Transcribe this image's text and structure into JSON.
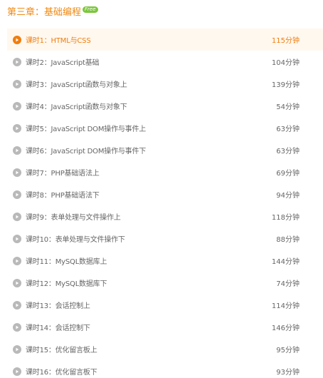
{
  "chapter": {
    "title": "第三章：基础编程",
    "badge": "Free"
  },
  "colors": {
    "accent": "#f07d0e",
    "active_background": "#fff8ef",
    "badge": "#7cc63d",
    "icon_inactive": "#b9b9b9",
    "text": "#666666"
  },
  "lessons": [
    {
      "label": "课时1：HTML与CSS",
      "duration": "115分钟",
      "active": true,
      "icon": "play-circle-icon"
    },
    {
      "label": "课时2：JavaScript基础",
      "duration": "104分钟",
      "active": false,
      "icon": "play-circle-icon"
    },
    {
      "label": "课时3：JavaScript函数与对象上",
      "duration": "139分钟",
      "active": false,
      "icon": "play-circle-icon"
    },
    {
      "label": "课时4：JavaScript函数与对象下",
      "duration": "54分钟",
      "active": false,
      "icon": "play-circle-icon"
    },
    {
      "label": "课时5：JavaScript DOM操作与事件上",
      "duration": "63分钟",
      "active": false,
      "icon": "play-circle-icon"
    },
    {
      "label": "课时6：JavaScript DOM操作与事件下",
      "duration": "63分钟",
      "active": false,
      "icon": "play-circle-icon"
    },
    {
      "label": "课时7：PHP基础语法上",
      "duration": "69分钟",
      "active": false,
      "icon": "play-circle-icon"
    },
    {
      "label": "课时8：PHP基础语法下",
      "duration": "94分钟",
      "active": false,
      "icon": "play-circle-icon"
    },
    {
      "label": "课时9：表单处理与文件操作上",
      "duration": "118分钟",
      "active": false,
      "icon": "play-circle-icon"
    },
    {
      "label": "课时10：表单处理与文件操作下",
      "duration": "88分钟",
      "active": false,
      "icon": "play-circle-icon"
    },
    {
      "label": "课时11：MySQL数据库上",
      "duration": "144分钟",
      "active": false,
      "icon": "play-circle-icon"
    },
    {
      "label": "课时12：MySQL数据库下",
      "duration": "74分钟",
      "active": false,
      "icon": "play-circle-icon"
    },
    {
      "label": "课时13：会话控制上",
      "duration": "114分钟",
      "active": false,
      "icon": "play-circle-icon"
    },
    {
      "label": "课时14：会话控制下",
      "duration": "146分钟",
      "active": false,
      "icon": "play-circle-icon"
    },
    {
      "label": "课时15：优化留言板上",
      "duration": "95分钟",
      "active": false,
      "icon": "play-circle-icon"
    },
    {
      "label": "课时16：优化留言板下",
      "duration": "93分钟",
      "active": false,
      "icon": "play-circle-icon"
    }
  ]
}
